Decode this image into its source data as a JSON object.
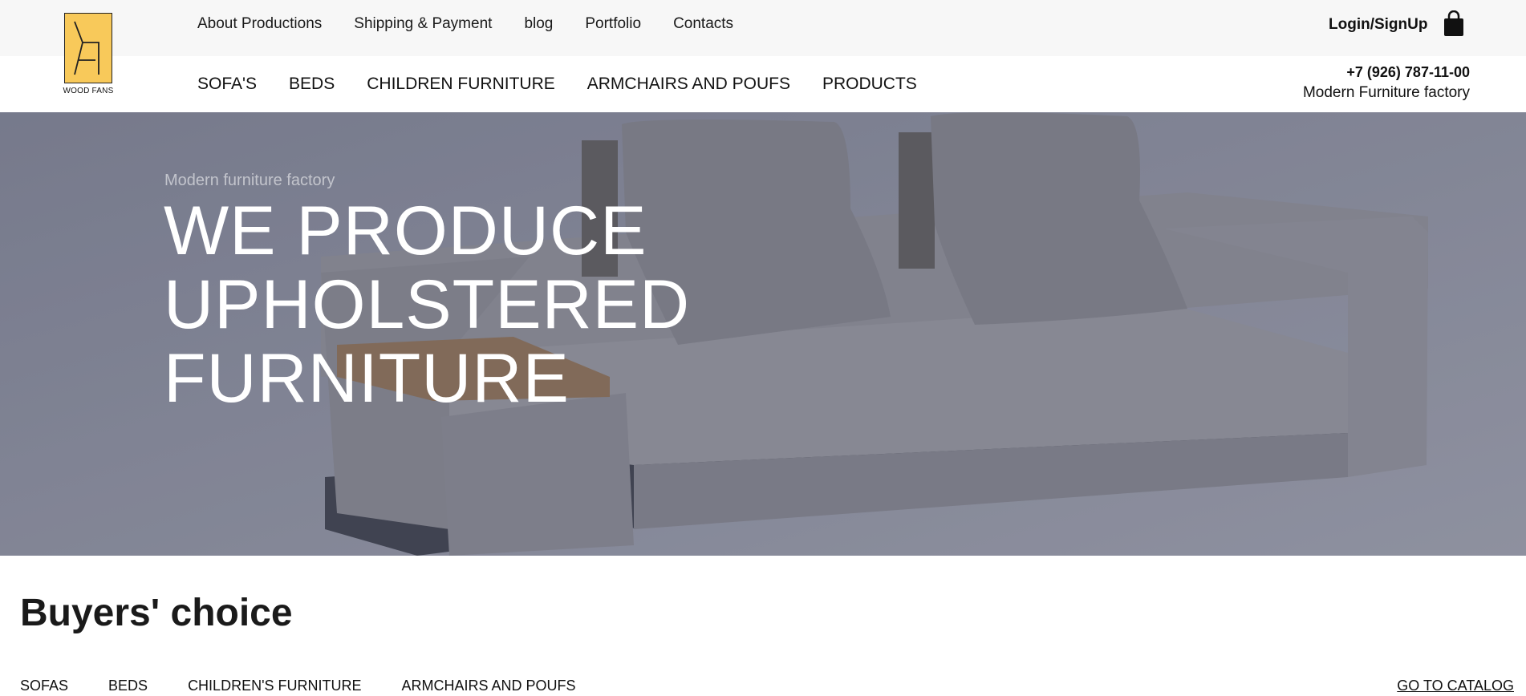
{
  "header": {
    "logo_text": "WOOD FANS",
    "top_menu": [
      "About Productions",
      "Shipping & Payment",
      "blog",
      "Portfolio",
      "Contacts"
    ],
    "login_label": "Login/SignUp",
    "cart_icon": "shopping-bag-icon",
    "main_menu": [
      "SOFA'S",
      "BEDS",
      "CHILDREN FURNITURE",
      "ARMCHAIRS AND POUFS",
      "PRODUCTS"
    ],
    "phone": "+7 (926) 787-11-00",
    "factory_label": "Modern Furniture factory"
  },
  "hero": {
    "subtitle": "Modern furniture factory",
    "title_lines": [
      "WE PRODUCE",
      "UPHOLSTERED",
      "FURNITURE"
    ]
  },
  "buyers_choice": {
    "title": "Buyers' choice",
    "tabs": [
      "SOFAS",
      "BEDS",
      "CHILDREN'S FURNITURE",
      "ARMCHAIRS AND POUFS"
    ],
    "catalog_link": "GO TO CATALOG"
  },
  "colors": {
    "logo_yellow": "#f8c95a",
    "topbar_bg": "#f7f7f7",
    "hero_bg": "#878a99"
  }
}
